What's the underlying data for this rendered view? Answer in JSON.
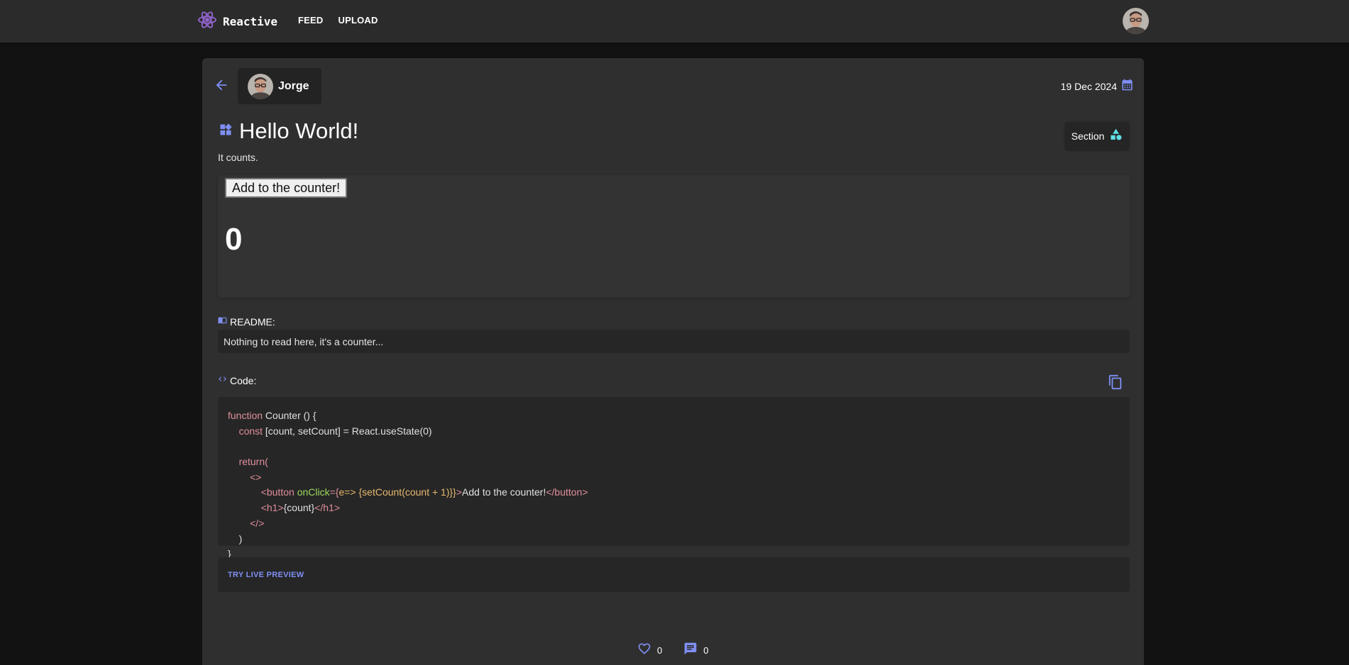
{
  "app": {
    "brand_name": "Reactive",
    "accent_color": "#7f8ff4",
    "nav": [
      {
        "label": "FEED"
      },
      {
        "label": "UPLOAD"
      }
    ]
  },
  "post": {
    "author": "Jorge",
    "date": "19 Dec 2024",
    "title": "Hello World!",
    "subtitle": "It counts.",
    "section_label": "Section",
    "preview": {
      "button_label": "Add to the counter!",
      "count": "0"
    },
    "readme_label": "README:",
    "readme_text": "Nothing to read here, it's a counter...",
    "code_label": "Code:",
    "code": {
      "l1_kw": "function",
      "l1_rest": " Counter () {",
      "l2_kw": "const",
      "l2_rest": " [count, setCount] = React.useState(0)",
      "l3_kw": "return",
      "l3_rest": "(",
      "l4": "<>",
      "l5_open": "<button",
      "l5_prop": "onClick",
      "l5_eq": "={",
      "l5_arrow": "e=>",
      "l5_call": " {setCount(count + 1)}}",
      "l5_close": ">",
      "l5_text": "Add to the counter!",
      "l5_end": "</button>",
      "l6_open": "<h1>",
      "l6_expr": "{count}",
      "l6_end": "</h1>",
      "l7": "</>",
      "l8": ")",
      "l9": "}"
    },
    "live_preview_label": "TRY LIVE PREVIEW",
    "likes": "0",
    "comments": "0"
  }
}
